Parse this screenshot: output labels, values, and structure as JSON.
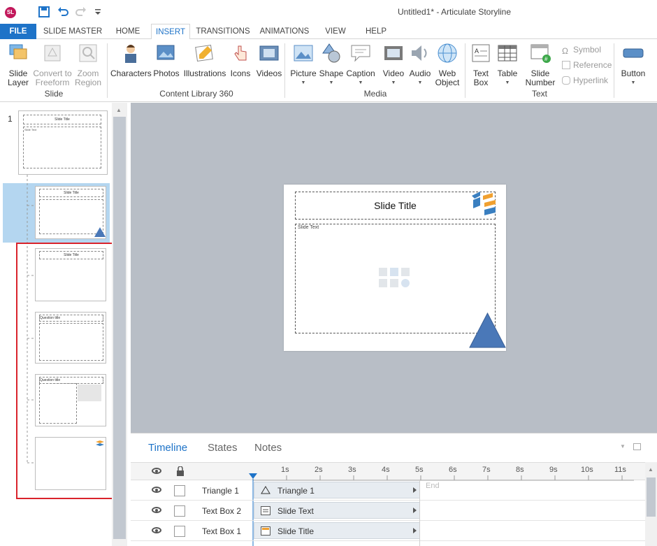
{
  "titlebar": {
    "logo_text": "SL",
    "title": "Untitled1* -  Articulate Storyline"
  },
  "tabs": [
    "FILE",
    "SLIDE MASTER",
    "HOME",
    "INSERT",
    "TRANSITIONS",
    "ANIMATIONS",
    "VIEW",
    "HELP"
  ],
  "active_tab": "INSERT",
  "ribbon": {
    "slide_layer": "Slide\nLayer",
    "convert_freeform": "Convert to\nFreeform",
    "zoom_region": "Zoom\nRegion",
    "group_slide": "Slide",
    "characters": "Characters",
    "photos": "Photos",
    "illustrations": "Illustrations",
    "icons": "Icons",
    "videos": "Videos",
    "group_content_library": "Content Library 360",
    "picture": "Picture",
    "shape": "Shape",
    "caption": "Caption",
    "video": "Video",
    "audio": "Audio",
    "web_object": "Web\nObject",
    "group_media": "Media",
    "text_box": "Text\nBox",
    "table": "Table",
    "slide_number": "Slide\nNumber",
    "symbol": "Symbol",
    "reference": "Reference",
    "hyperlink": "Hyperlink",
    "group_text": "Text",
    "button": "Button"
  },
  "slide_panel": {
    "master_number": "1",
    "master_title": "Slide Title",
    "master_text": "Slide Text",
    "layout1_title": "Slide Title",
    "layout2_title": "Slide Title",
    "layout3_title": "Question title",
    "layout4_title": "Question title"
  },
  "canvas": {
    "slide_title": "Slide Title",
    "slide_text": "Slide Text"
  },
  "timeline": {
    "tabs": [
      "Timeline",
      "States",
      "Notes"
    ],
    "ticks": [
      "1s",
      "2s",
      "3s",
      "4s",
      "5s",
      "6s",
      "7s",
      "8s",
      "9s",
      "10s",
      "11s"
    ],
    "end_label": "End",
    "rows": [
      {
        "name": "Triangle 1",
        "bar": "Triangle 1"
      },
      {
        "name": "Text Box 2",
        "bar": "Slide Text"
      },
      {
        "name": "Text Box 1",
        "bar": "Slide Title"
      }
    ]
  },
  "colors": {
    "accent": "#1e73c8",
    "highlight_red": "#d9232b",
    "canvas_bg": "#b8bec6",
    "triangle": "#4a78b8"
  }
}
